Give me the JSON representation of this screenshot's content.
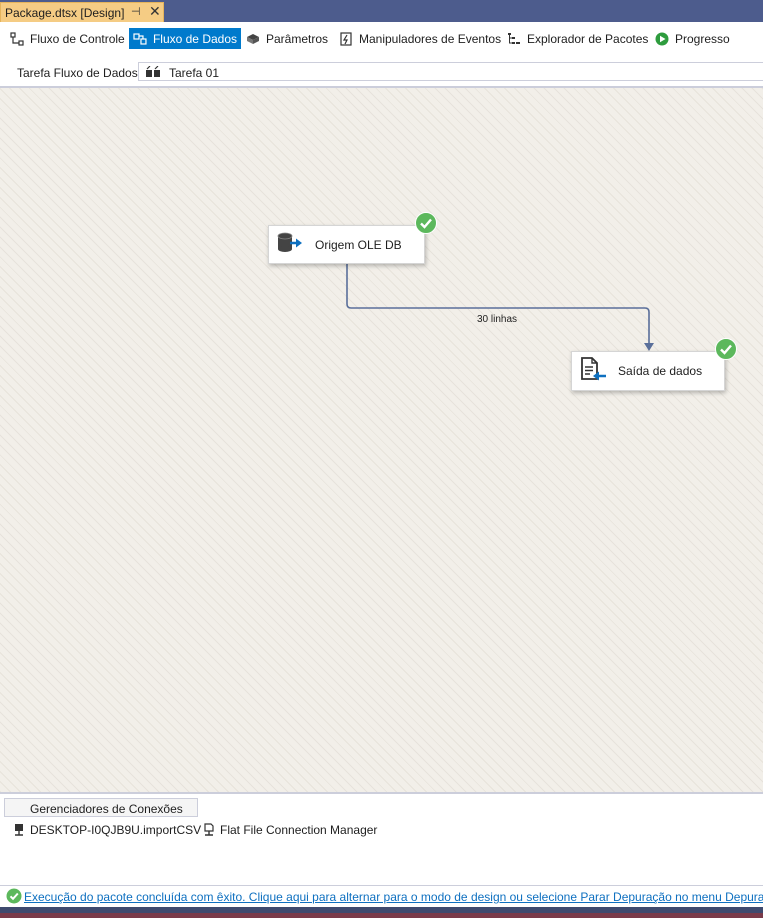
{
  "document_tab": {
    "title": "Package.dtsx [Design]",
    "pin_glyph": "⊣",
    "close_glyph": "✕"
  },
  "designer_tabs": [
    {
      "label": "Fluxo de Controle",
      "icon": "control-flow-icon",
      "active": false
    },
    {
      "label": "Fluxo de Dados",
      "icon": "data-flow-icon",
      "active": true
    },
    {
      "label": "Parâmetros",
      "icon": "parameters-icon",
      "active": false
    },
    {
      "label": "Manipuladores de Eventos",
      "icon": "event-handlers-icon",
      "active": false
    },
    {
      "label": "Explorador de Pacotes",
      "icon": "package-explorer-icon",
      "active": false
    },
    {
      "label": "Progresso",
      "icon": "progress-icon",
      "active": false
    }
  ],
  "task_bar": {
    "label": "Tarefa Fluxo de Dados:",
    "selected_task": "Tarefa 01"
  },
  "canvas": {
    "components": [
      {
        "name": "Origem OLE DB",
        "icon": "ole-db-source-icon",
        "status": "success"
      },
      {
        "name": "Saída de dados",
        "icon": "flat-file-destination-icon",
        "status": "success"
      }
    ],
    "path_label": "30 linhas"
  },
  "connection_managers": {
    "tab_label": "Gerenciadores de Conexões",
    "items": [
      {
        "label": "DESKTOP-I0QJB9U.importCSV",
        "icon": "ole-db-connection-icon"
      },
      {
        "label": "Flat File Connection Manager",
        "icon": "flat-file-connection-icon"
      }
    ]
  },
  "status": {
    "message": "Execução do pacote concluída com êxito. Clique aqui para alternar para o modo de design ou selecione Parar Depuração no menu Depurar.",
    "icon": "success-icon"
  },
  "colors": {
    "accent": "#007acc",
    "tab_gold": "#f5cc84",
    "success": "#5cb85c",
    "path": "#5a6f9a"
  }
}
